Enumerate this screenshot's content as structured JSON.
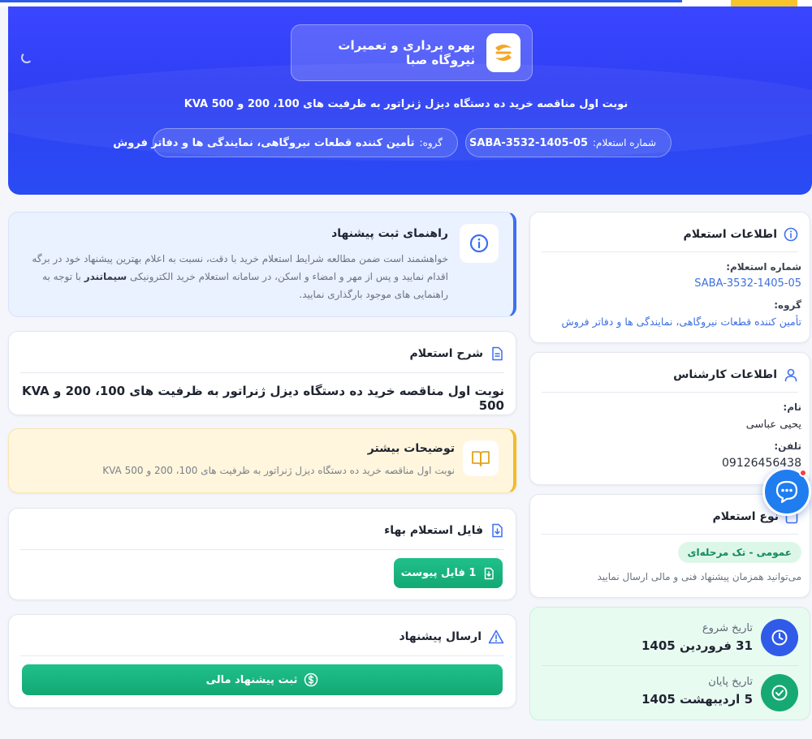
{
  "hero": {
    "brand_name": "بهره برداری و تعمیرات نیروگاه صبا",
    "title": "نوبت اول مناقصه خرید ده دستگاه دیزل ژنراتور به ظرفیت های 100، 200 و KVA 500",
    "chip_id_label": "شماره استعلام:",
    "chip_id_value": "SABA-3532-1405-05",
    "chip_group_label": "گروه:",
    "chip_group_value": "تأمین کننده قطعات نیروگاهی، نمایندگی ها و دفاتر فروش"
  },
  "guide": {
    "title": "راهنمای ثبت پیشنهاد",
    "text_before": "خواهشمند است ضمن مطالعه شرایط استعلام خرید با دقت، نسبت به اعلام بهترین پیشنهاد خود در برگه اقدام نمایید و پس از مهر و امضاء و اسکن، در سامانه استعلام خرید الکترونیکی ",
    "text_bold": "سیماتندر",
    "text_after": " با توجه به راهنمایی های موجود بارگذاری نمایید."
  },
  "description": {
    "title": "شرح استعلام",
    "text": "نوبت اول مناقصه خرید ده دستگاه دیزل ژنراتور به ظرفیت های 100، 200 و KVA 500"
  },
  "more": {
    "title": "توضیحات بیشتر",
    "text": "نوبت اول مناقصه خرید ده دستگاه دیزل ژنراتور به ظرفیت های 100، 200 و KVA 500"
  },
  "file": {
    "title": "فایل استعلام بهاء",
    "button_label": "1 فایل پیوست"
  },
  "send": {
    "title": "ارسال پیشنهاد",
    "button_label": "ثبت پیشنهاد مالی"
  },
  "info": {
    "title": "اطلاعات استعلام",
    "number_label": "شماره استعلام:",
    "number_value": "SABA-3532-1405-05",
    "group_label": "گروه:",
    "group_value": "تأمین کننده قطعات نیروگاهی، نمایندگی ها و دفاتر فروش"
  },
  "expert": {
    "title": "اطلاعات کارشناس",
    "name_label": "نام:",
    "name_value": "یحیی عباسی",
    "phone_label": "تلفن:",
    "phone_value": "09126456438"
  },
  "type": {
    "title": "نوع استعلام",
    "badge": "عمومی - تک مرحله‌ای",
    "note": "می‌توانید همزمان پیشنهاد فنی و مالی ارسال نمایید"
  },
  "dates": {
    "start_label": "تاریخ شروع",
    "start_value": "31 فروردین 1405",
    "end_label": "تاریخ پایان",
    "end_value": "5 اردیبهشت 1405"
  },
  "colors": {
    "primary": "#2f3ff3",
    "accent_green": "#13a874",
    "accent_yellow": "#f2bb2a",
    "link": "#3c6fe0"
  }
}
